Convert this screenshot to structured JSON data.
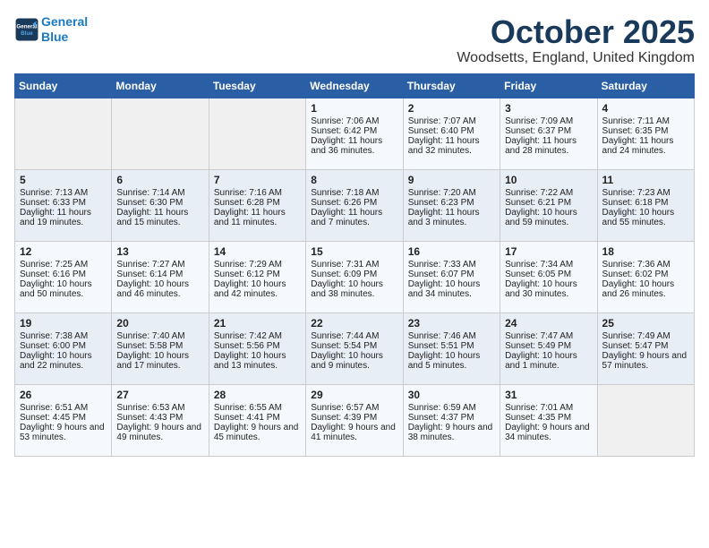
{
  "header": {
    "logo_line1": "General",
    "logo_line2": "Blue",
    "month": "October 2025",
    "location": "Woodsetts, England, United Kingdom"
  },
  "weekdays": [
    "Sunday",
    "Monday",
    "Tuesday",
    "Wednesday",
    "Thursday",
    "Friday",
    "Saturday"
  ],
  "weeks": [
    [
      {
        "day": "",
        "info": ""
      },
      {
        "day": "",
        "info": ""
      },
      {
        "day": "",
        "info": ""
      },
      {
        "day": "1",
        "info": "Sunrise: 7:06 AM\nSunset: 6:42 PM\nDaylight: 11 hours and 36 minutes."
      },
      {
        "day": "2",
        "info": "Sunrise: 7:07 AM\nSunset: 6:40 PM\nDaylight: 11 hours and 32 minutes."
      },
      {
        "day": "3",
        "info": "Sunrise: 7:09 AM\nSunset: 6:37 PM\nDaylight: 11 hours and 28 minutes."
      },
      {
        "day": "4",
        "info": "Sunrise: 7:11 AM\nSunset: 6:35 PM\nDaylight: 11 hours and 24 minutes."
      }
    ],
    [
      {
        "day": "5",
        "info": "Sunrise: 7:13 AM\nSunset: 6:33 PM\nDaylight: 11 hours and 19 minutes."
      },
      {
        "day": "6",
        "info": "Sunrise: 7:14 AM\nSunset: 6:30 PM\nDaylight: 11 hours and 15 minutes."
      },
      {
        "day": "7",
        "info": "Sunrise: 7:16 AM\nSunset: 6:28 PM\nDaylight: 11 hours and 11 minutes."
      },
      {
        "day": "8",
        "info": "Sunrise: 7:18 AM\nSunset: 6:26 PM\nDaylight: 11 hours and 7 minutes."
      },
      {
        "day": "9",
        "info": "Sunrise: 7:20 AM\nSunset: 6:23 PM\nDaylight: 11 hours and 3 minutes."
      },
      {
        "day": "10",
        "info": "Sunrise: 7:22 AM\nSunset: 6:21 PM\nDaylight: 10 hours and 59 minutes."
      },
      {
        "day": "11",
        "info": "Sunrise: 7:23 AM\nSunset: 6:18 PM\nDaylight: 10 hours and 55 minutes."
      }
    ],
    [
      {
        "day": "12",
        "info": "Sunrise: 7:25 AM\nSunset: 6:16 PM\nDaylight: 10 hours and 50 minutes."
      },
      {
        "day": "13",
        "info": "Sunrise: 7:27 AM\nSunset: 6:14 PM\nDaylight: 10 hours and 46 minutes."
      },
      {
        "day": "14",
        "info": "Sunrise: 7:29 AM\nSunset: 6:12 PM\nDaylight: 10 hours and 42 minutes."
      },
      {
        "day": "15",
        "info": "Sunrise: 7:31 AM\nSunset: 6:09 PM\nDaylight: 10 hours and 38 minutes."
      },
      {
        "day": "16",
        "info": "Sunrise: 7:33 AM\nSunset: 6:07 PM\nDaylight: 10 hours and 34 minutes."
      },
      {
        "day": "17",
        "info": "Sunrise: 7:34 AM\nSunset: 6:05 PM\nDaylight: 10 hours and 30 minutes."
      },
      {
        "day": "18",
        "info": "Sunrise: 7:36 AM\nSunset: 6:02 PM\nDaylight: 10 hours and 26 minutes."
      }
    ],
    [
      {
        "day": "19",
        "info": "Sunrise: 7:38 AM\nSunset: 6:00 PM\nDaylight: 10 hours and 22 minutes."
      },
      {
        "day": "20",
        "info": "Sunrise: 7:40 AM\nSunset: 5:58 PM\nDaylight: 10 hours and 17 minutes."
      },
      {
        "day": "21",
        "info": "Sunrise: 7:42 AM\nSunset: 5:56 PM\nDaylight: 10 hours and 13 minutes."
      },
      {
        "day": "22",
        "info": "Sunrise: 7:44 AM\nSunset: 5:54 PM\nDaylight: 10 hours and 9 minutes."
      },
      {
        "day": "23",
        "info": "Sunrise: 7:46 AM\nSunset: 5:51 PM\nDaylight: 10 hours and 5 minutes."
      },
      {
        "day": "24",
        "info": "Sunrise: 7:47 AM\nSunset: 5:49 PM\nDaylight: 10 hours and 1 minute."
      },
      {
        "day": "25",
        "info": "Sunrise: 7:49 AM\nSunset: 5:47 PM\nDaylight: 9 hours and 57 minutes."
      }
    ],
    [
      {
        "day": "26",
        "info": "Sunrise: 6:51 AM\nSunset: 4:45 PM\nDaylight: 9 hours and 53 minutes."
      },
      {
        "day": "27",
        "info": "Sunrise: 6:53 AM\nSunset: 4:43 PM\nDaylight: 9 hours and 49 minutes."
      },
      {
        "day": "28",
        "info": "Sunrise: 6:55 AM\nSunset: 4:41 PM\nDaylight: 9 hours and 45 minutes."
      },
      {
        "day": "29",
        "info": "Sunrise: 6:57 AM\nSunset: 4:39 PM\nDaylight: 9 hours and 41 minutes."
      },
      {
        "day": "30",
        "info": "Sunrise: 6:59 AM\nSunset: 4:37 PM\nDaylight: 9 hours and 38 minutes."
      },
      {
        "day": "31",
        "info": "Sunrise: 7:01 AM\nSunset: 4:35 PM\nDaylight: 9 hours and 34 minutes."
      },
      {
        "day": "",
        "info": ""
      }
    ]
  ]
}
